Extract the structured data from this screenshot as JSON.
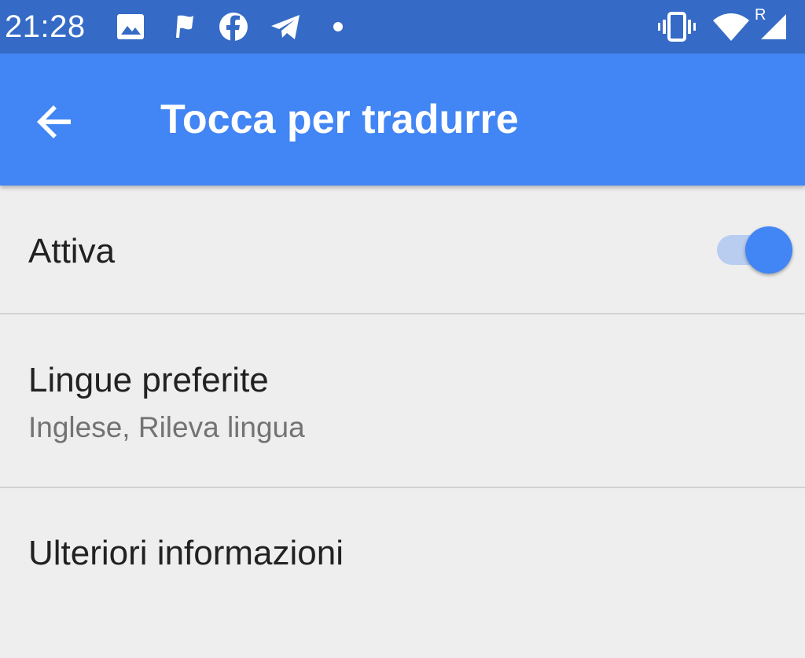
{
  "status_bar": {
    "time": "21:28",
    "icons": [
      "image-icon",
      "flag-icon",
      "facebook-icon",
      "telegram-icon",
      "dot-icon",
      "vibrate-icon",
      "wifi-icon",
      "signal-icon"
    ],
    "roaming_label": "R",
    "background_color": "#356bc6"
  },
  "app_bar": {
    "title": "Tocca per tradurre",
    "back_icon": "arrow-back-icon",
    "background_color": "#4285f4"
  },
  "settings": {
    "enable": {
      "label": "Attiva",
      "toggle_on": true
    },
    "preferred_languages": {
      "label": "Lingue preferite",
      "summary": "Inglese, Rileva lingua"
    },
    "more_info": {
      "label": "Ulteriori informazioni"
    }
  },
  "colors": {
    "accent": "#4285f4",
    "toggle_track": "#b8cdf0",
    "background": "#eeeeee"
  }
}
